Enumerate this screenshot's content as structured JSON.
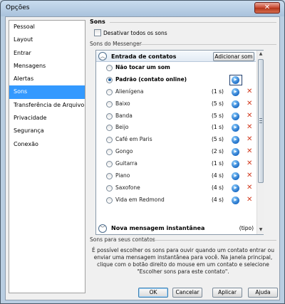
{
  "window": {
    "title": "Opções",
    "close_glyph": "✕"
  },
  "nav": {
    "items": [
      {
        "label": "Pessoal"
      },
      {
        "label": "Layout"
      },
      {
        "label": "Entrar"
      },
      {
        "label": "Mensagens"
      },
      {
        "label": "Alertas"
      },
      {
        "label": "Sons",
        "selected": true
      },
      {
        "label": "Transferência de Arquivo"
      },
      {
        "label": "Privacidade"
      },
      {
        "label": "Segurança"
      },
      {
        "label": "Conexão"
      }
    ]
  },
  "section": {
    "heading": "Sons",
    "disable_all": "Desativar todos os sons",
    "messenger_group": "Sons do Messenger",
    "contacts_group": "Sons para seus contatos",
    "description": "É possível escolher os sons para ouvir quando um contato entrar ou enviar uma mensagem instantânea para você. Na janela principal, clique com o botão direito do mouse em um contato e selecione \"Escolher sons para este contato\"."
  },
  "list": {
    "group1": {
      "label": "Entrada de contatos",
      "add_button": "Adicionar som",
      "chevron": "︿"
    },
    "rows": [
      {
        "label": "Não tocar um som",
        "duration": "",
        "selected": false,
        "bold": true,
        "play": false,
        "delete": false
      },
      {
        "label": "Padrão (contato online)",
        "duration": "",
        "selected": true,
        "bold": true,
        "play": true,
        "delete": false
      },
      {
        "label": "Alienígena",
        "duration": "(1 s)",
        "selected": false,
        "bold": false,
        "play": true,
        "delete": true
      },
      {
        "label": "Baixo",
        "duration": "(5 s)",
        "selected": false,
        "bold": false,
        "play": true,
        "delete": true
      },
      {
        "label": "Banda",
        "duration": "(5 s)",
        "selected": false,
        "bold": false,
        "play": true,
        "delete": true
      },
      {
        "label": "Beijo",
        "duration": "(1 s)",
        "selected": false,
        "bold": false,
        "play": true,
        "delete": true
      },
      {
        "label": "Café em Paris",
        "duration": "(5 s)",
        "selected": false,
        "bold": false,
        "play": true,
        "delete": true
      },
      {
        "label": "Gongo",
        "duration": "(2 s)",
        "selected": false,
        "bold": false,
        "play": true,
        "delete": true
      },
      {
        "label": "Guitarra",
        "duration": "(1 s)",
        "selected": false,
        "bold": false,
        "play": true,
        "delete": true
      },
      {
        "label": "Piano",
        "duration": "(4 s)",
        "selected": false,
        "bold": false,
        "play": true,
        "delete": true
      },
      {
        "label": "Saxofone",
        "duration": "(4 s)",
        "selected": false,
        "bold": false,
        "play": true,
        "delete": true
      },
      {
        "label": "Vida em Redmond",
        "duration": "(4 s)",
        "selected": false,
        "bold": false,
        "play": true,
        "delete": true
      }
    ],
    "group2": {
      "label": "Nova mensagem instantânea",
      "suffix": "(tipo)",
      "chevron": "﹀"
    },
    "icons": {
      "play": "play-icon",
      "delete": "delete-x-icon",
      "play_glyph": "▶",
      "delete_glyph": "✕"
    }
  },
  "scrollbar": {
    "up": "▲",
    "down": "▼"
  },
  "buttons": {
    "ok": "OK",
    "cancel": "Cancelar",
    "apply": "Aplicar",
    "help": "Ajuda"
  }
}
